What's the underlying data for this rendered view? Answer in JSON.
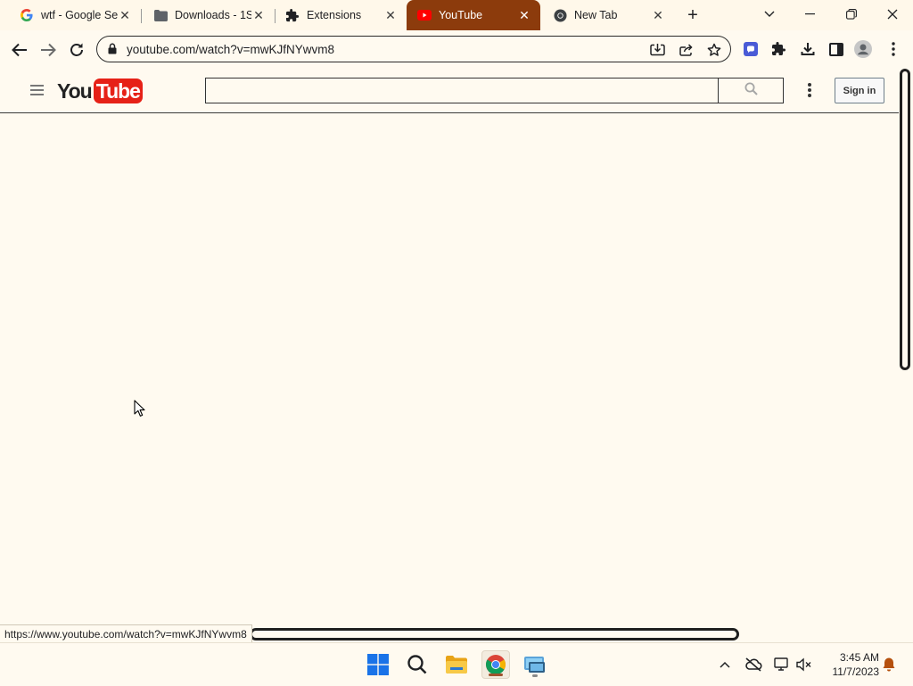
{
  "tabs": [
    {
      "title": "wtf - Google Se",
      "icon": "google-icon",
      "close": "✕"
    },
    {
      "title": "Downloads - 1S",
      "icon": "folder-icon",
      "close": "✕"
    },
    {
      "title": "Extensions",
      "icon": "puzzle-icon",
      "close": "✕"
    },
    {
      "title": "YouTube",
      "icon": "youtube-icon",
      "close": "✕",
      "active": true
    },
    {
      "title": "New Tab",
      "icon": "chrome-icon",
      "close": "✕"
    }
  ],
  "new_tab_label": "+",
  "omnibox": {
    "url": "youtube.com/watch?v=mwKJfNYwvm8"
  },
  "youtube": {
    "logo_you": "You",
    "logo_tube": "Tube",
    "search_placeholder": "",
    "sign_in_label": "Sign in"
  },
  "status_bar": {
    "url": "https://www.youtube.com/watch?v=mwKJfNYwvm8"
  },
  "taskbar": {
    "apps": [
      "start-icon",
      "search-icon",
      "file-explorer-icon",
      "chrome-icon",
      "remote-desktop-icon"
    ],
    "time": "3:45 AM",
    "date": "11/7/2023"
  },
  "colors": {
    "active_tab": "#8c3b0c",
    "page_background": "#fffaf0",
    "youtube_red": "#e62117"
  }
}
